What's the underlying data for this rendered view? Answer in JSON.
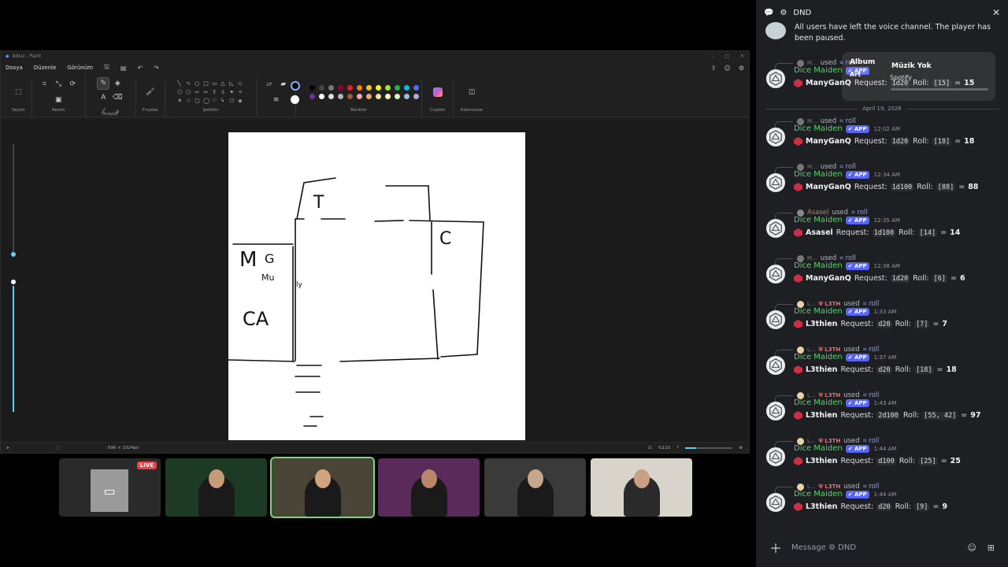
{
  "paint": {
    "title": "Adsız - Paint",
    "menu": [
      "Dosya",
      "Düzenle",
      "Görünüm"
    ],
    "groups": {
      "select": "Seçim",
      "image": "Resim",
      "tools": "Araçlar",
      "brushes": "Fırçalar",
      "shapes": "Şekiller",
      "colors": "Renkler",
      "copilot": "Copilot",
      "layers": "Katmanlar"
    },
    "status": {
      "size": "690 × 1024px",
      "zoom": "%110"
    },
    "palette": [
      "#000000",
      "#464646",
      "#787878",
      "#990030",
      "#ed1c24",
      "#ff7e00",
      "#ffc20e",
      "#fff200",
      "#a8e61d",
      "#22b14c",
      "#00b7ef",
      "#4d6df3",
      "#6f3198",
      "#ffffff",
      "#dcdcdc",
      "#b4b4b4",
      "#9c5a3c",
      "#ffa3b1",
      "#e5aa7a",
      "#f5e49c",
      "#fff9bd",
      "#d3f9bc",
      "#9dbbe1",
      "#b5a5d5"
    ],
    "canvas_text": {
      "t": "T",
      "c": "C",
      "m": "M",
      "g": "G",
      "mu": "Mu",
      "ca": "CA",
      "ly": "ly"
    }
  },
  "tiles": [
    {
      "name": "screen-share-tile",
      "badge": "LIVE",
      "color": "#2a2a2a"
    },
    {
      "name": "user-tile-2",
      "color": "#1c3a24"
    },
    {
      "name": "user-tile-3",
      "color": "#4a4436"
    },
    {
      "name": "user-tile-4",
      "color": "#5a2a5a"
    },
    {
      "name": "user-tile-5",
      "color": "#3a3a3a"
    },
    {
      "name": "user-tile-6",
      "color": "#d8d4cc"
    }
  ],
  "discord": {
    "channel": "DND",
    "system_message": "All users have left the voice channel. The player has been paused.",
    "date_divider": "April 19, 2026",
    "compose_placeholder": "Message ⚙ DND",
    "spotify": {
      "album": "Album",
      "art": "Art",
      "track": "Müzik Yok",
      "source": "Spotify"
    },
    "messages": [
      {
        "user": "ManyGanQ",
        "short": "M...",
        "tag": "",
        "command": "roll",
        "time": "",
        "dice": "1d20",
        "rolls": "[15]",
        "total": "15"
      },
      {
        "user": "ManyGanQ",
        "short": "M...",
        "tag": "",
        "command": "roll",
        "time": "12:02 AM",
        "dice": "1d20",
        "rolls": "[18]",
        "total": "18"
      },
      {
        "user": "ManyGanQ",
        "short": "M...",
        "tag": "",
        "command": "roll",
        "time": "12:34 AM",
        "dice": "1d100",
        "rolls": "[88]",
        "total": "88"
      },
      {
        "user": "Asasel",
        "short": "Asasel",
        "tag": "",
        "command": "roll",
        "time": "12:35 AM",
        "dice": "1d100",
        "rolls": "[14]",
        "total": "14"
      },
      {
        "user": "ManyGanQ",
        "short": "M...",
        "tag": "",
        "command": "roll",
        "time": "12:38 AM",
        "dice": "1d20",
        "rolls": "[6]",
        "total": "6"
      },
      {
        "user": "L3thien",
        "short": "L...",
        "tag": "L3TH",
        "command": "roll",
        "time": "1:33 AM",
        "dice": "d20",
        "rolls": "[7]",
        "total": "7"
      },
      {
        "user": "L3thien",
        "short": "L...",
        "tag": "L3TH",
        "command": "roll",
        "time": "1:37 AM",
        "dice": "d20",
        "rolls": "[18]",
        "total": "18"
      },
      {
        "user": "L3thien",
        "short": "L...",
        "tag": "L3TH",
        "command": "roll",
        "time": "1:43 AM",
        "dice": "2d100",
        "rolls": "[55, 42]",
        "total": "97"
      },
      {
        "user": "L3thien",
        "short": "L...",
        "tag": "L3TH",
        "command": "roll",
        "time": "1:44 AM",
        "dice": "d100",
        "rolls": "[25]",
        "total": "25"
      },
      {
        "user": "L3thien",
        "short": "L...",
        "tag": "L3TH",
        "command": "roll",
        "time": "1:44 AM",
        "dice": "d20",
        "rolls": "[9]",
        "total": "9"
      }
    ],
    "bot": {
      "name": "Dice Maiden",
      "badge": "✔ APP",
      "used": "used",
      "request": "Request:",
      "roll": "Roll:",
      "eq": "="
    }
  }
}
